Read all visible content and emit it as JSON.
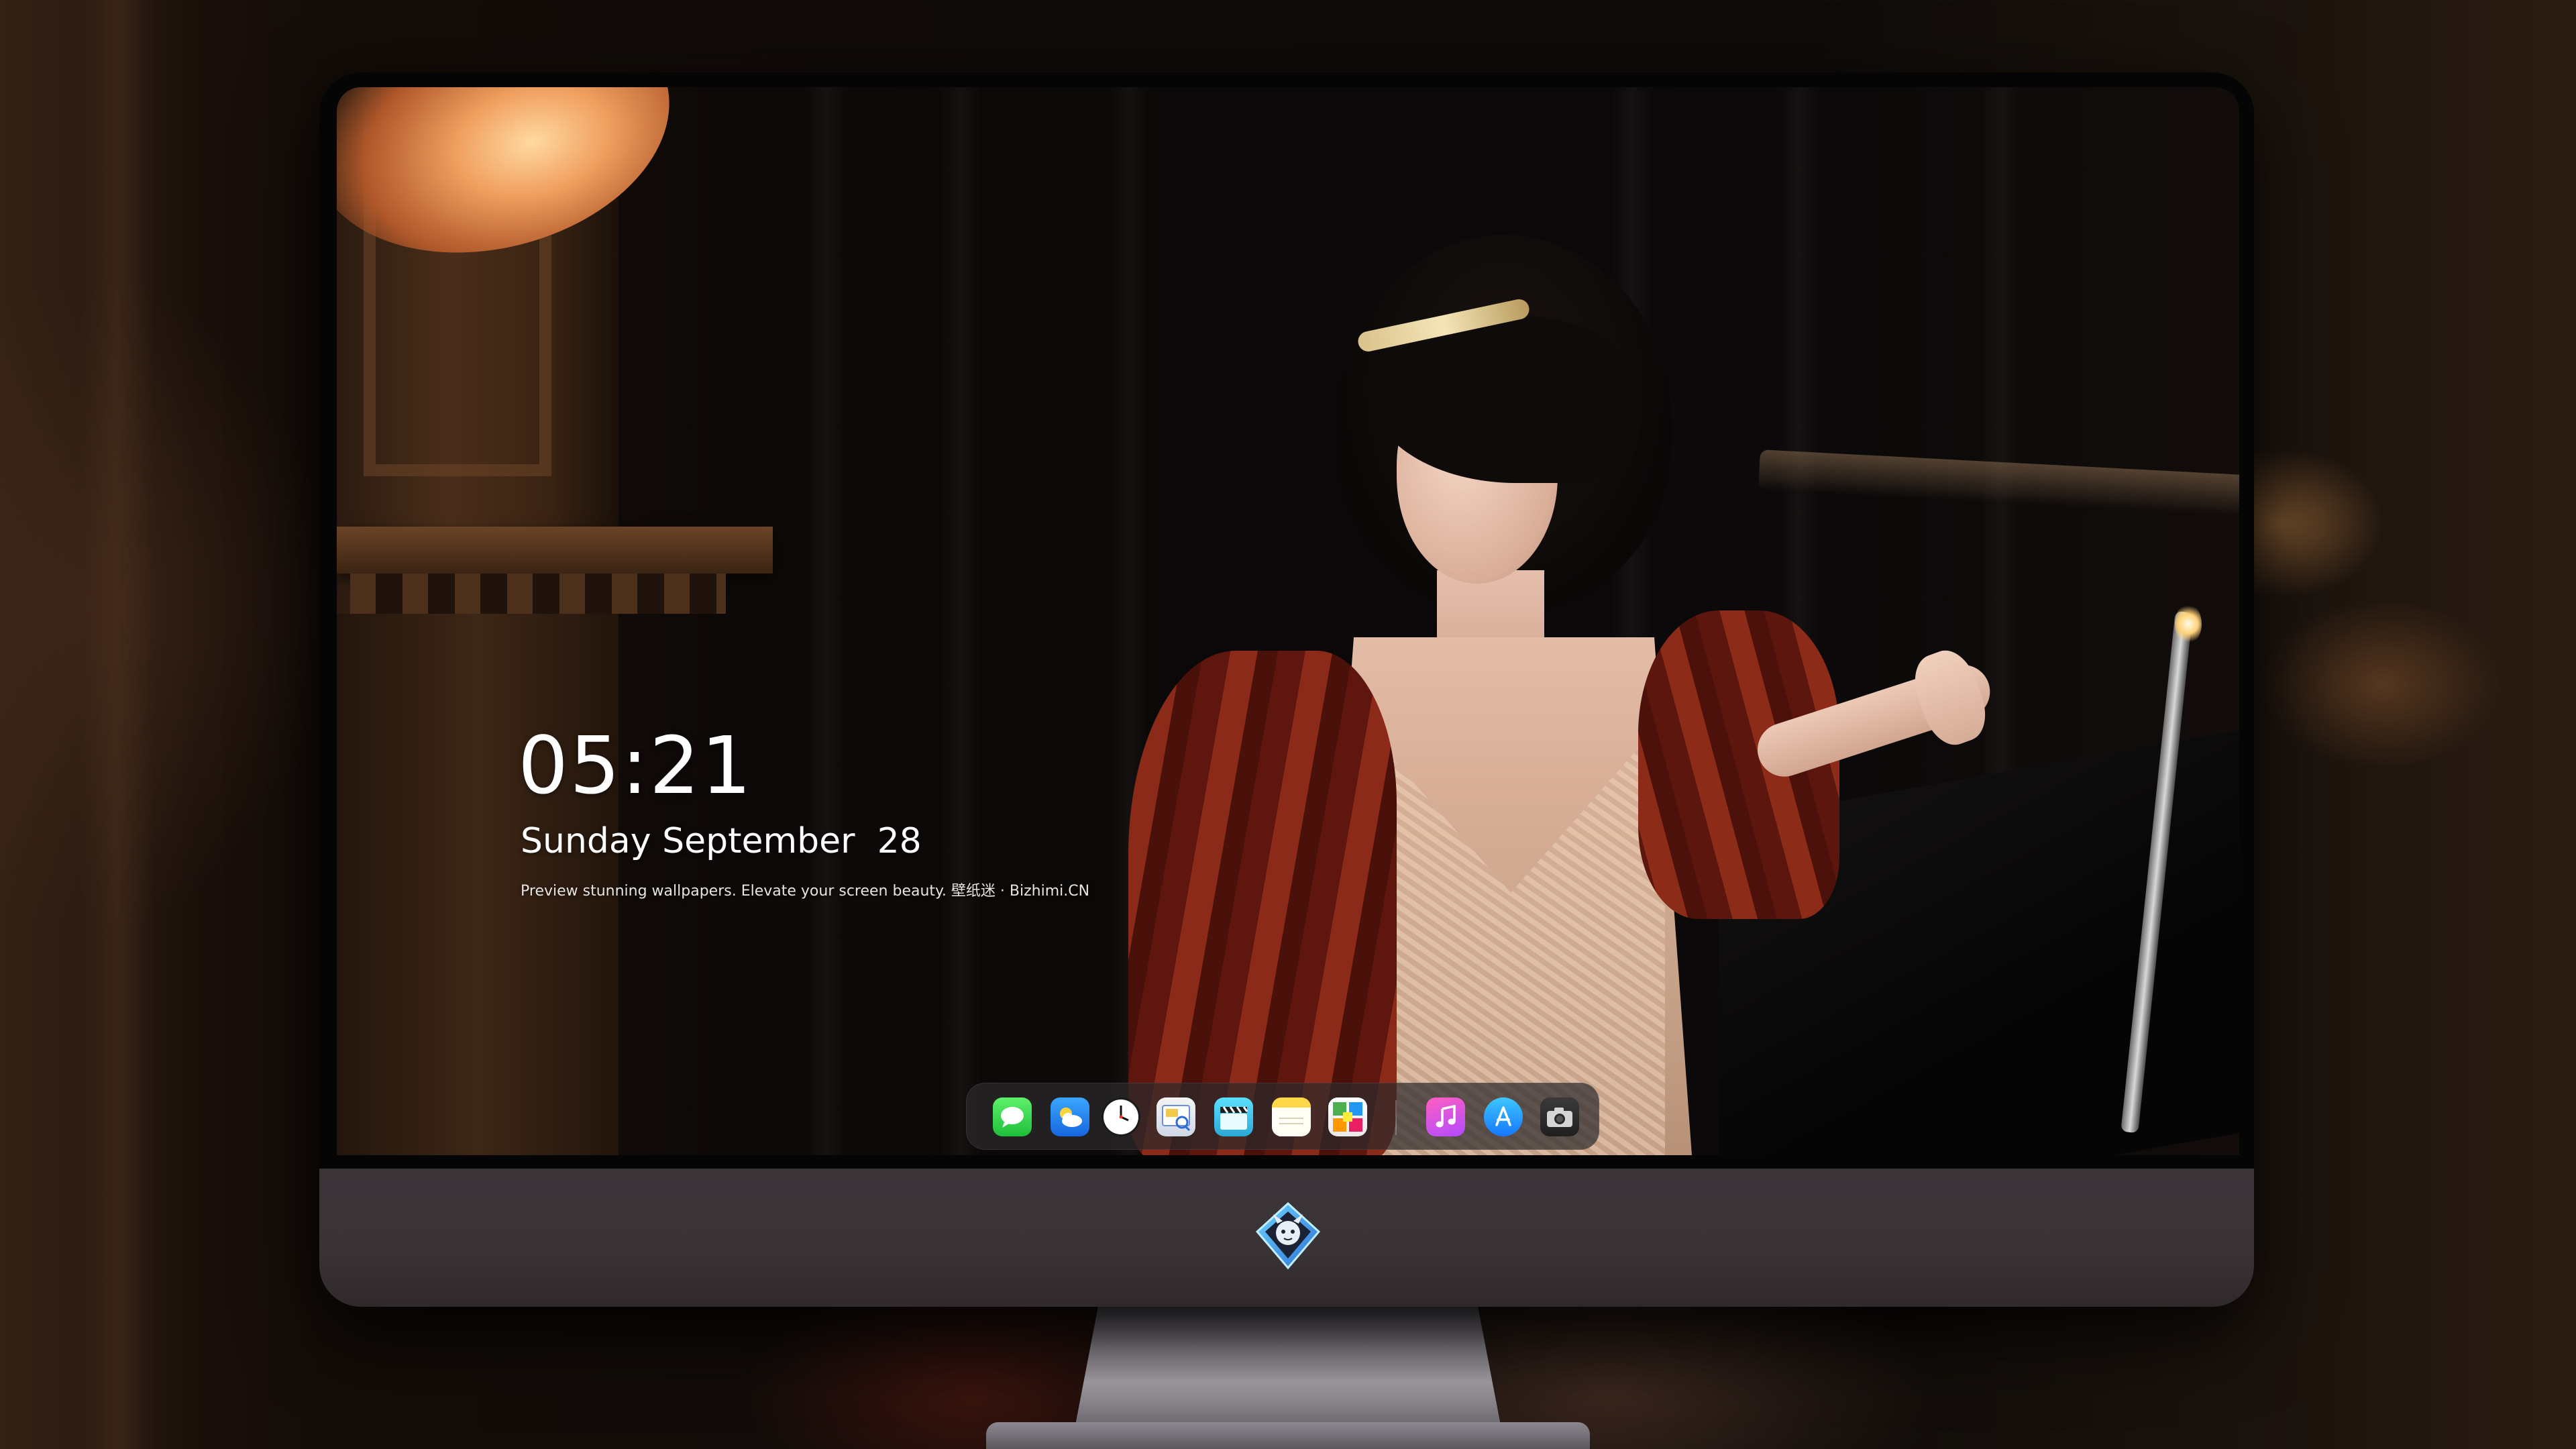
{
  "lockscreen": {
    "time": "05:21",
    "date": "Sunday September  28",
    "tagline": "Preview stunning wallpapers. Elevate your screen beauty. 壁纸迷 · Bizhimi.CN"
  },
  "dock": {
    "apps": [
      {
        "id": "messages",
        "icon": "messages-icon"
      },
      {
        "id": "weather",
        "icon": "weather-icon"
      },
      {
        "id": "clock",
        "icon": "clock-icon"
      },
      {
        "id": "preview",
        "icon": "preview-icon"
      },
      {
        "id": "video",
        "icon": "clapperboard-icon"
      },
      {
        "id": "notes",
        "icon": "notes-icon"
      },
      {
        "id": "photos",
        "icon": "photos-icon"
      },
      {
        "id": "music",
        "icon": "music-icon"
      },
      {
        "id": "app-store",
        "icon": "app-store-icon"
      },
      {
        "id": "camera",
        "icon": "camera-icon"
      }
    ]
  },
  "colors": {
    "chin": "#3a3336",
    "dock_bg": "#2d2a2c",
    "text": "#ffffff"
  }
}
